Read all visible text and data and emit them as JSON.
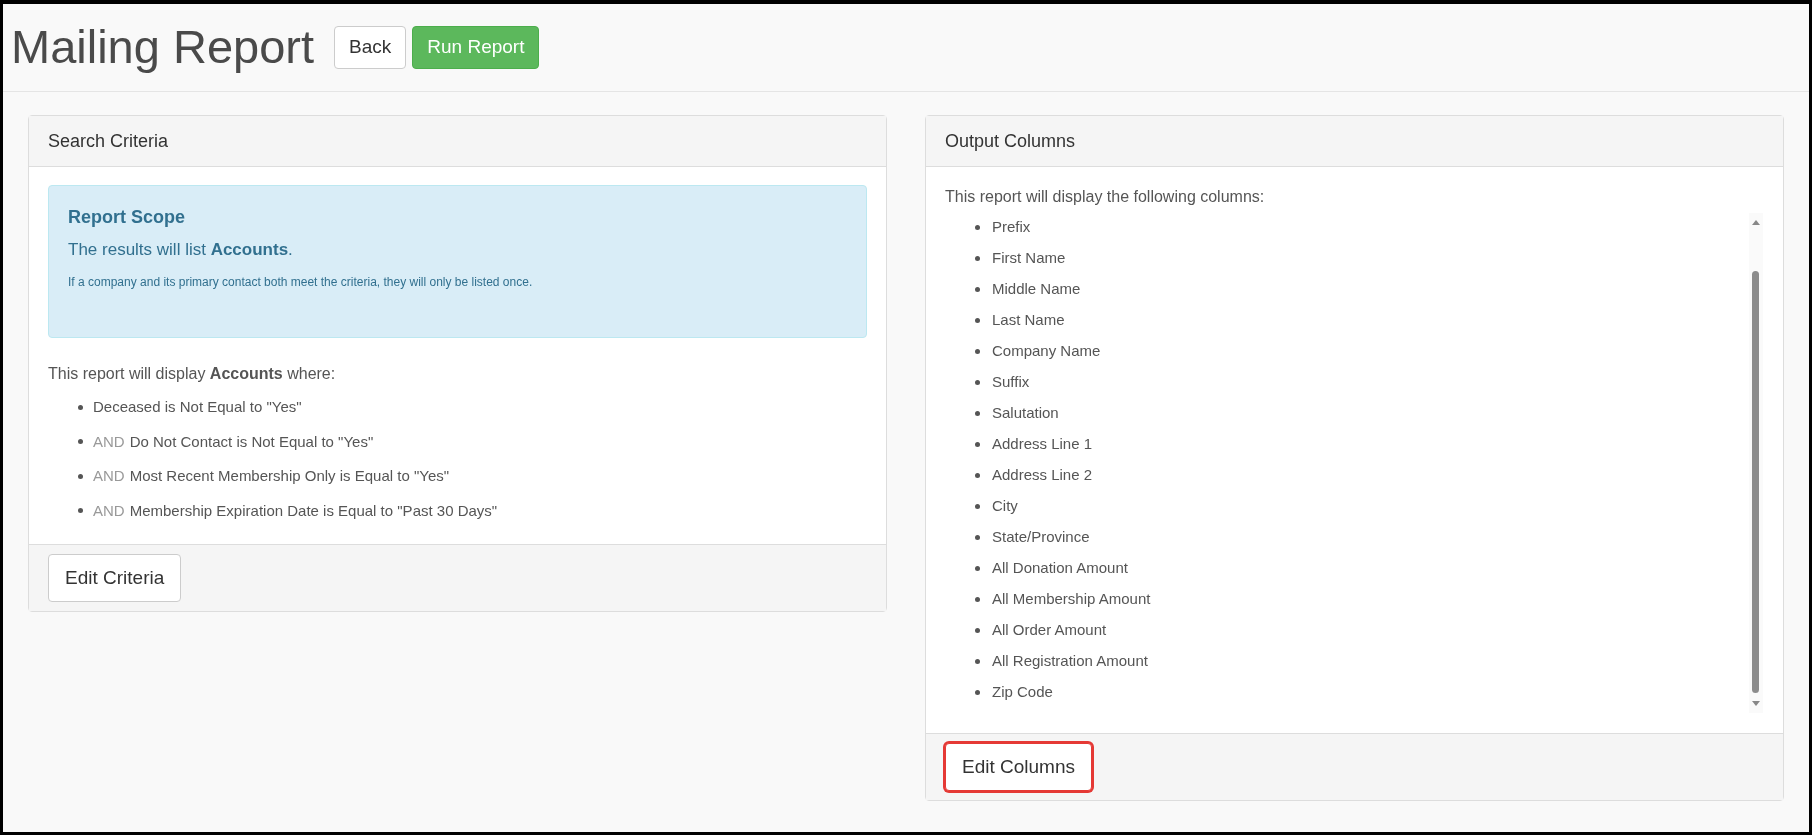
{
  "page": {
    "title": "Mailing Report"
  },
  "header_buttons": [
    {
      "label": "Back",
      "kind": "default"
    },
    {
      "label": "Run Report",
      "kind": "success"
    }
  ],
  "search_criteria": {
    "title": "Search Criteria",
    "scope": {
      "heading": "Report Scope",
      "text": "The results will list **Accounts**.",
      "note": "If a company and its primary contact both meet the criteria, they will only be listed once."
    },
    "intro": "This report will display **Accounts** where:",
    "conditions": [
      {
        "text": "Deceased is Not Equal to \"Yes\""
      },
      {
        "connector": "AND",
        "text": "Do Not Contact is Not Equal to \"Yes\""
      },
      {
        "connector": "AND",
        "text": "Most Recent Membership Only is Equal to \"Yes\""
      },
      {
        "connector": "AND",
        "text": "Membership Expiration Date is Equal to \"Past 30 Days\""
      }
    ],
    "button": {
      "label": "Edit Criteria",
      "highlighted": false
    }
  },
  "output_columns": {
    "title": "Output Columns",
    "intro": "This report will display the following columns:",
    "columns": [
      "Prefix",
      "First Name",
      "Middle Name",
      "Last Name",
      "Company Name",
      "Suffix",
      "Salutation",
      "Address Line 1",
      "Address Line 2",
      "City",
      "State/Province",
      "All Donation Amount",
      "All Membership Amount",
      "All Order Amount",
      "All Registration Amount",
      "Zip Code"
    ],
    "button": {
      "label": "Edit Columns",
      "highlighted": true
    }
  }
}
